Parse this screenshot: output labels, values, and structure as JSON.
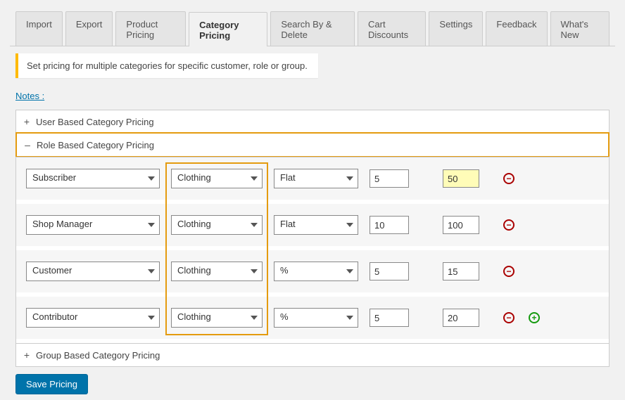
{
  "tabs": [
    {
      "label": "Import"
    },
    {
      "label": "Export"
    },
    {
      "label": "Product Pricing"
    },
    {
      "label": "Category Pricing"
    },
    {
      "label": "Search By & Delete"
    },
    {
      "label": "Cart Discounts"
    },
    {
      "label": "Settings"
    },
    {
      "label": "Feedback"
    },
    {
      "label": "What's New"
    }
  ],
  "active_tab_index": 3,
  "notice": "Set pricing for multiple categories for specific customer, role or group.",
  "notes_label": "Notes :",
  "accordions": {
    "user": {
      "title": "User Based Category Pricing"
    },
    "role": {
      "title": "Role Based Category Pricing"
    },
    "group": {
      "title": "Group Based Category Pricing"
    }
  },
  "role_rows": [
    {
      "role": "Subscriber",
      "category": "Clothing",
      "type": "Flat",
      "qty": "5",
      "price": "50",
      "price_hl": true
    },
    {
      "role": "Shop Manager",
      "category": "Clothing",
      "type": "Flat",
      "qty": "10",
      "price": "100",
      "price_hl": false
    },
    {
      "role": "Customer",
      "category": "Clothing",
      "type": "%",
      "qty": "5",
      "price": "15",
      "price_hl": false
    },
    {
      "role": "Contributor",
      "category": "Clothing",
      "type": "%",
      "qty": "5",
      "price": "20",
      "price_hl": false
    }
  ],
  "save_label": "Save Pricing"
}
